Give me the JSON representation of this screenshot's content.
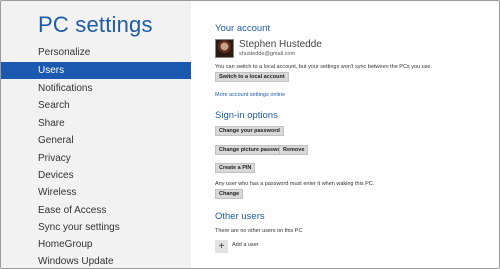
{
  "sidebar": {
    "title": "PC settings",
    "items": [
      {
        "label": "Personalize"
      },
      {
        "label": "Users"
      },
      {
        "label": "Notifications"
      },
      {
        "label": "Search"
      },
      {
        "label": "Share"
      },
      {
        "label": "General"
      },
      {
        "label": "Privacy"
      },
      {
        "label": "Devices"
      },
      {
        "label": "Wireless"
      },
      {
        "label": "Ease of Access"
      },
      {
        "label": "Sync your settings"
      },
      {
        "label": "HomeGroup"
      },
      {
        "label": "Windows Update"
      }
    ],
    "selected": "Users"
  },
  "account": {
    "heading": "Your account",
    "name": "Stephen Hustedde",
    "email": "shustedde@gmail.com",
    "switch_info": "You can switch to a local account, but your settings won't sync between the PCs you use.",
    "switch_button": "Switch to a local account",
    "more_link": "More account settings online"
  },
  "signin": {
    "heading": "Sign-in options",
    "change_password": "Change your password",
    "change_picture_password": "Change picture password",
    "remove": "Remove",
    "create_pin": "Create a PIN",
    "wake_info": "Any user who has a password must enter it when waking this PC.",
    "change": "Change"
  },
  "other_users": {
    "heading": "Other users",
    "empty_text": "There are no other users on this PC",
    "add_user": "Add a user",
    "add_icon": "plus-icon"
  },
  "colors": {
    "accent": "#1d5ca8",
    "selected_bg": "#1b58b0",
    "sidebar_bg": "#f2f2f2"
  }
}
